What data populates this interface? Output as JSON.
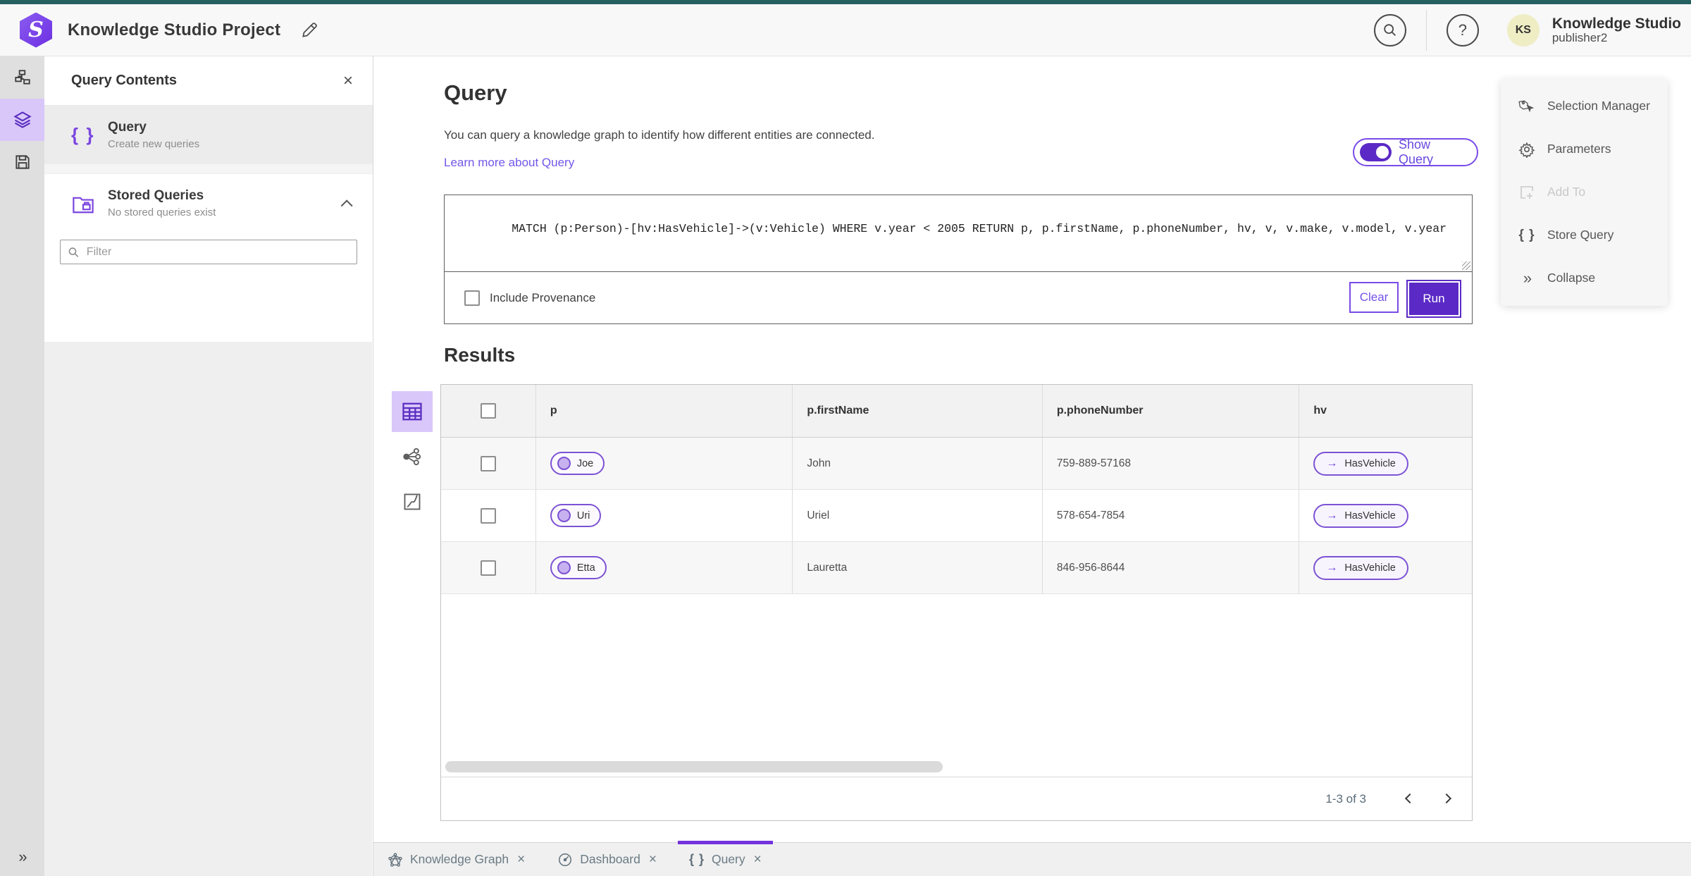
{
  "header": {
    "title": "Knowledge Studio Project",
    "user": {
      "initials": "KS",
      "name": "Knowledge Studio",
      "role": "publisher2"
    }
  },
  "contents_panel": {
    "title": "Query Contents",
    "query_item": {
      "title": "Query",
      "subtitle": "Create new queries"
    },
    "stored_item": {
      "title": "Stored Queries",
      "subtitle": "No stored queries exist"
    },
    "filter_placeholder": "Filter"
  },
  "query_section": {
    "title": "Query",
    "description": "You can query a knowledge graph to identify how different entities are connected.",
    "learn_link": "Learn more about Query",
    "toggle_label": "Show Query",
    "query_text": "MATCH (p:Person)-[hv:HasVehicle]->(v:Vehicle) WHERE v.year < 2005 RETURN p, p.firstName, p.phoneNumber, hv, v, v.make, v.model, v.year",
    "include_provenance": "Include Provenance",
    "clear_label": "Clear",
    "run_label": "Run"
  },
  "results": {
    "title": "Results",
    "columns": {
      "p": "p",
      "firstName": "p.firstName",
      "phoneNumber": "p.phoneNumber",
      "hv": "hv"
    },
    "rows": [
      {
        "p": "Joe",
        "firstName": "John",
        "phoneNumber": "759-889-57168",
        "hv": "HasVehicle"
      },
      {
        "p": "Uri",
        "firstName": "Uriel",
        "phoneNumber": "578-654-7854",
        "hv": "HasVehicle"
      },
      {
        "p": "Etta",
        "firstName": "Lauretta",
        "phoneNumber": "846-956-8644",
        "hv": "HasVehicle"
      }
    ],
    "pagination": "1-3 of 3"
  },
  "tools_panel": {
    "selection_manager": "Selection Manager",
    "parameters": "Parameters",
    "add_to": "Add To",
    "store_query": "Store Query",
    "collapse": "Collapse"
  },
  "tabs": [
    {
      "label": "Knowledge Graph"
    },
    {
      "label": "Dashboard"
    },
    {
      "label": "Query"
    }
  ],
  "glyphs": {
    "close": "×",
    "braces": "{ }",
    "arrow": "→",
    "collapse": "»",
    "help": "?",
    "logo": "S"
  },
  "colors": {
    "accent_purple": "#5b2ac6",
    "accent_light_purple": "#d9c7fa",
    "link_purple": "#7256e8",
    "teal_topbar": "#266162",
    "avatar_yellow": "#efedc4",
    "tab_indicator": "#7333dd"
  }
}
